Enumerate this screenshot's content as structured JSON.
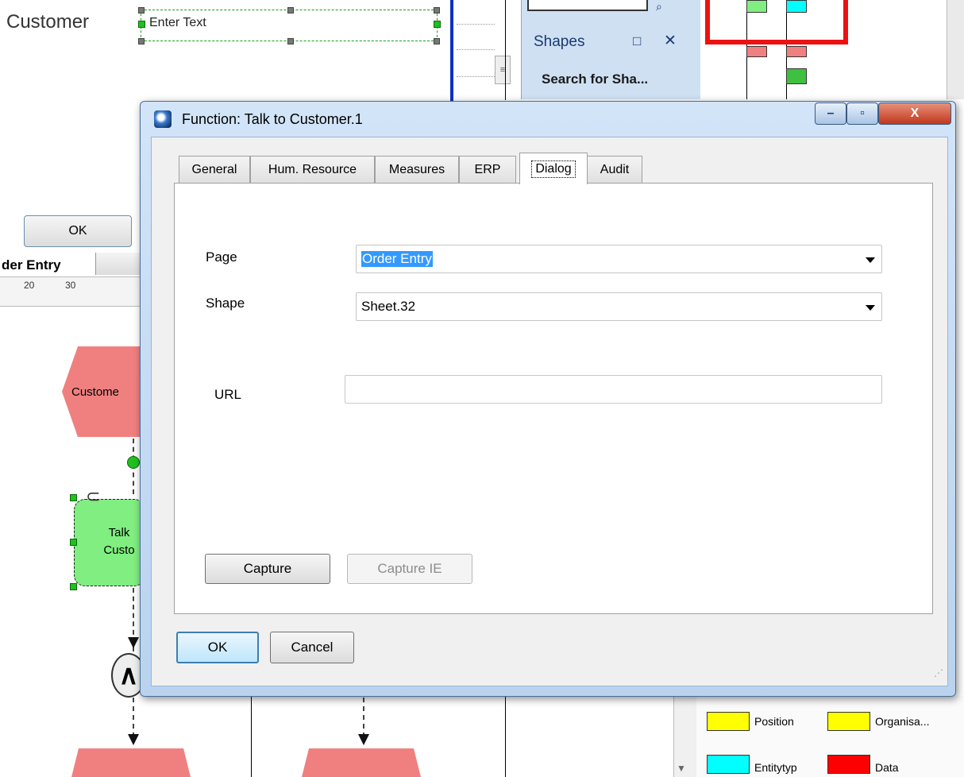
{
  "background": {
    "customer_label": "Customer",
    "enter_text": "Enter Text",
    "ok_button": "OK",
    "page_tab": "der Entry",
    "ruler_labels": [
      "20",
      "30"
    ],
    "customer_shape_label": "Custome",
    "talk_shape_label_line1": "Talk",
    "talk_shape_label_line2": "Custo",
    "and_gate": "∧",
    "shapes_panel": {
      "title": "Shapes",
      "dock_button": "□",
      "close_button": "✕",
      "search": "Search for Sha..."
    },
    "legend": [
      {
        "label": "Position",
        "color": "#ffff00"
      },
      {
        "label": "Organisa...",
        "color": "#ffff00"
      },
      {
        "label": "Entitytyp",
        "color": "#00ffff"
      },
      {
        "label": "Data",
        "color": "#ff0000"
      }
    ]
  },
  "dialog": {
    "title": "Function: Talk to Customer.1",
    "tabs": [
      {
        "label": "General",
        "active": false
      },
      {
        "label": "Hum. Resource",
        "active": false
      },
      {
        "label": "Measures",
        "active": false
      },
      {
        "label": "ERP",
        "active": false
      },
      {
        "label": "Dialog",
        "active": true
      },
      {
        "label": "Audit",
        "active": false
      }
    ],
    "page_label": "Page",
    "page_value": "Order Entry",
    "shape_label": "Shape",
    "shape_value": "Sheet.32",
    "url_label": "URL",
    "url_value": "",
    "capture_button": "Capture",
    "capture_ie_button": "Capture IE",
    "ok_button": "OK",
    "cancel_button": "Cancel",
    "window_buttons": {
      "minimize": "–",
      "maximize": "▫",
      "close": "X"
    }
  }
}
